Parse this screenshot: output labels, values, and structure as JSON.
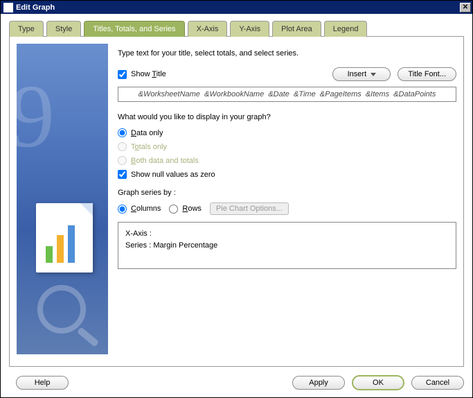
{
  "window": {
    "title": "Edit Graph"
  },
  "tabs": {
    "type": "Type",
    "style": "Style",
    "titles": "Titles, Totals, and Series",
    "xaxis": "X-Axis",
    "yaxis": "Y-Axis",
    "plot": "Plot Area",
    "legend": "Legend",
    "active": "titles"
  },
  "intro": "Type text for your title, select totals, and select series.",
  "show_title": {
    "label": "Show Title",
    "checked": true,
    "underline": "T"
  },
  "insert_btn": "Insert",
  "title_font_btn": "Title Font...",
  "title_value": "&WorksheetName  &WorkbookName  &Date  &Time  &PageItems  &Items  &DataPoints",
  "question": "What would you like to display in your graph?",
  "opt_data_only": {
    "label": "Data only",
    "underline": "D"
  },
  "opt_totals_only": {
    "label": "Totals only",
    "underline": "o"
  },
  "opt_both": {
    "label": "Both data and totals",
    "underline": "B"
  },
  "show_null": {
    "label": "Show null values as zero",
    "checked": true
  },
  "graph_series_by": "Graph series by :",
  "opt_columns": {
    "label": "Columns",
    "underline": "C"
  },
  "opt_rows": {
    "label": "Rows",
    "underline": "R"
  },
  "pie_btn": "Pie Chart Options...",
  "axis_box": {
    "line1": "X-Axis :",
    "line2": "Series : Margin Percentage"
  },
  "footer": {
    "help": "Help",
    "apply": "Apply",
    "ok": "OK",
    "cancel": "Cancel"
  }
}
